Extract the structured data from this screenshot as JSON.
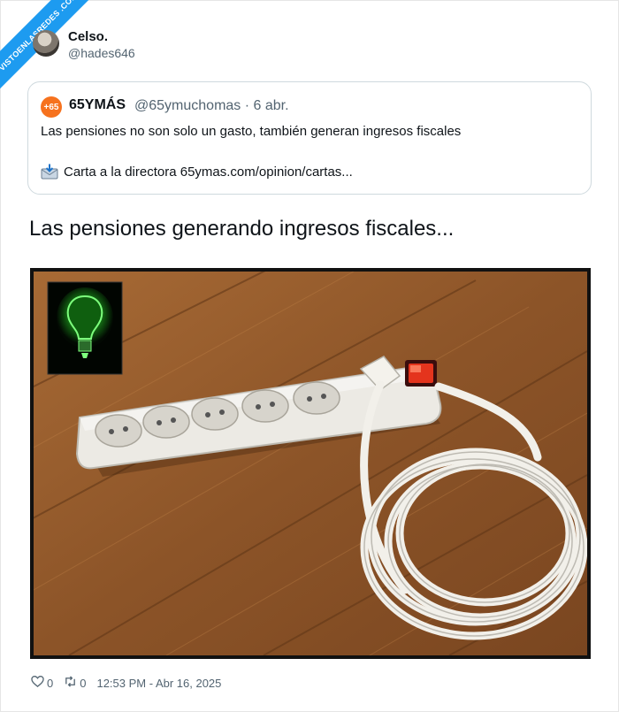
{
  "watermark": {
    "text": "VISTOENLASREDES .COM"
  },
  "author": {
    "name": "Celso.",
    "handle": "@hades646"
  },
  "quoted_tweet": {
    "logo_text": "+65",
    "name": "65YMÁS",
    "meta": "@65ymuchomas · 6 abr.",
    "text": "Las pensiones no son solo un gasto, también generan ingresos fiscales",
    "link_line": "Carta a la directora 65ymas.com/opinion/cartas..."
  },
  "tweet_text": "Las pensiones generando ingresos fiscales...",
  "media": {
    "icon": "power-strip-photo",
    "inset_icon": "green-lightbulb-icon"
  },
  "footer": {
    "likes": "0",
    "retweets": "0",
    "timestamp": "12:53 PM - Abr 16, 2025"
  },
  "colors": {
    "accent": "#1d9bf0",
    "brand_orange": "#f6721e",
    "muted": "#536471"
  }
}
